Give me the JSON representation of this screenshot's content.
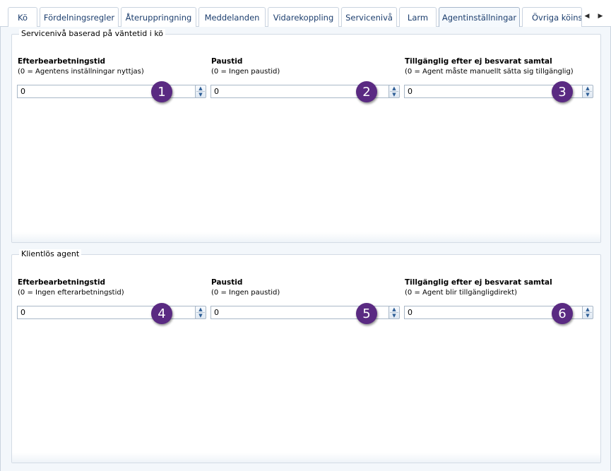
{
  "tabs": [
    {
      "label": "Kö"
    },
    {
      "label": "Fördelningsregler"
    },
    {
      "label": "Återuppringning"
    },
    {
      "label": "Meddelanden"
    },
    {
      "label": "Vidarekoppling"
    },
    {
      "label": "Servicenivå"
    },
    {
      "label": "Larm"
    },
    {
      "label": "Agentinställningar"
    },
    {
      "label": "Övriga köinstä"
    }
  ],
  "active_tab": "Agentinställningar",
  "tab_scroll": {
    "left_icon": "triangle-left-icon",
    "right_icon": "triangle-right-icon"
  },
  "groups": [
    {
      "title": "Servicenivå baserad på väntetid i kö",
      "fields": [
        {
          "label": "Efterbearbetningstid",
          "hint": "(0 = Agentens inställningar nyttjas)",
          "value": "0",
          "badge": "1"
        },
        {
          "label": "Paustid",
          "hint": "(0 = Ingen paustid)",
          "value": "0",
          "badge": "2"
        },
        {
          "label": "Tillgänglig efter ej besvarat samtal",
          "hint": "(0 = Agent måste manuellt sätta sig tillgänglig)",
          "value": "0",
          "badge": "3"
        }
      ]
    },
    {
      "title": "Klientlös agent",
      "fields": [
        {
          "label": "Efterbearbetningstid",
          "hint": "(0 = Ingen efterarbetningstid)",
          "value": "0",
          "badge": "4"
        },
        {
          "label": "Paustid",
          "hint": "(0 = Ingen paustid)",
          "value": "0",
          "badge": "5"
        },
        {
          "label": "Tillgänglig efter ej besvarat samtal",
          "hint": "(0 = Agent blir tillgängligdirekt)",
          "value": "0",
          "badge": "6"
        }
      ]
    }
  ],
  "spinner": {
    "up_glyph": "▲",
    "down_glyph": "▼"
  },
  "colors": {
    "badge": "#5a2a82",
    "tab_text": "#1c3e6e",
    "panel_bg": "#f3f7fb",
    "border": "#c9d3df"
  }
}
